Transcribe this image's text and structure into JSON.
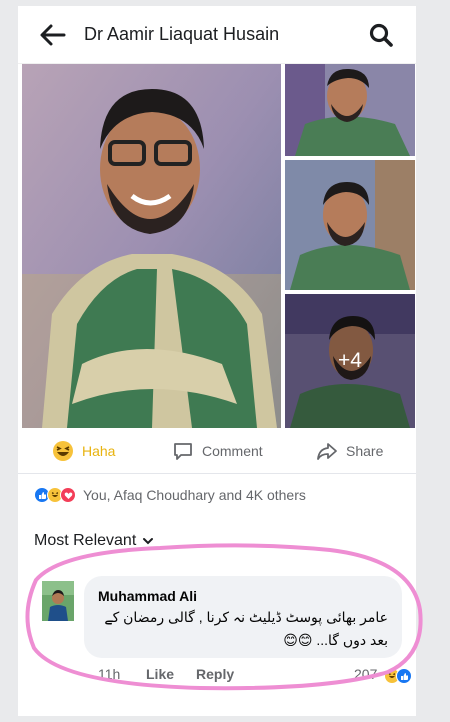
{
  "header": {
    "title": "Dr Aamir Liaquat Husain"
  },
  "photos": {
    "more_count": "+4"
  },
  "actions": {
    "haha": "Haha",
    "comment": "Comment",
    "share": "Share"
  },
  "reactions": {
    "summary": "You, Afaq Choudhary and 4K others"
  },
  "comments": {
    "sort_label": "Most Relevant",
    "items": [
      {
        "author": "Muhammad Ali",
        "text": "عامر بھائی پوسٹ ڈیلیٹ نہ کرنا , گالی رمضان کے بعد دوں گا... 😊😊",
        "time": "11h",
        "like": "Like",
        "reply": "Reply",
        "reaction_count": "207"
      }
    ]
  },
  "colors": {
    "haha": "#f7c23a",
    "like": "#1877f2",
    "love": "#f33e58",
    "highlight": "#ee8ed3"
  }
}
